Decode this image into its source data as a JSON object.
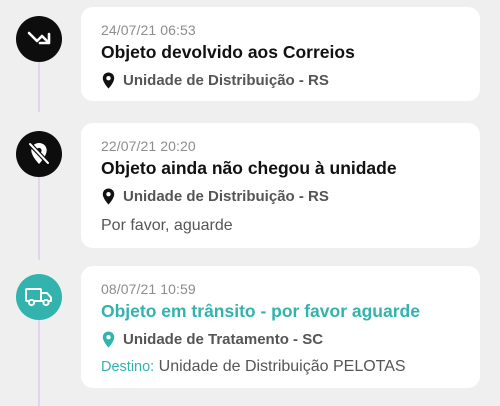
{
  "colors": {
    "accent": "#32b3ad",
    "dark_node": "#0d0d0d",
    "line": "#e3d3ee"
  },
  "events": [
    {
      "icon": "returned-arrow-icon",
      "date": "24/07/21 06:53",
      "title": "Objeto devolvido aos Correios",
      "location": "Unidade de Distribuição - RS"
    },
    {
      "icon": "location-off-icon",
      "date": "22/07/21 20:20",
      "title": "Objeto ainda não chegou à unidade",
      "location": "Unidade de Distribuição - RS",
      "note": "Por favor, aguarde"
    },
    {
      "icon": "truck-icon",
      "date": "08/07/21 10:59",
      "title": "Objeto em trânsito - por favor aguarde",
      "location": "Unidade de Tratamento - SC",
      "destination_label": "Destino:",
      "destination": "Unidade de Distribuição PELOTAS"
    }
  ]
}
